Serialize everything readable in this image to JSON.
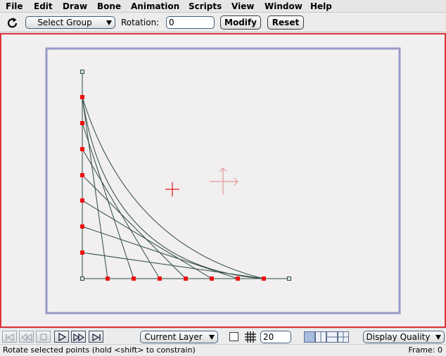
{
  "menu": [
    "File",
    "Edit",
    "Draw",
    "Bone",
    "Animation",
    "Scripts",
    "View",
    "Window",
    "Help"
  ],
  "toolbar": {
    "group_select": "Select Group",
    "rotation_label": "Rotation:",
    "rotation_value": "0",
    "modify_label": "Modify",
    "reset_label": "Reset",
    "tool_icon": "rotate-icon"
  },
  "bottom": {
    "layer_select": "Current Layer",
    "grid_size": "20",
    "grid_checked": false,
    "quality_select": "Display Quality",
    "playback_buttons": [
      "rewind-to-start",
      "step-back",
      "stop",
      "play",
      "step-forward",
      "jump-to-end"
    ]
  },
  "status": {
    "message": "Rotate selected points (hold <shift> to constrain)",
    "frame": "Frame: 0"
  },
  "colors": {
    "workspace_border": "#e0303a",
    "frame_border": "#9a9ac8",
    "curve_stroke": "#2e4a44",
    "point_selected": "#ee1111",
    "pivot": "#e04040",
    "move_handle": "#e59a9a"
  }
}
